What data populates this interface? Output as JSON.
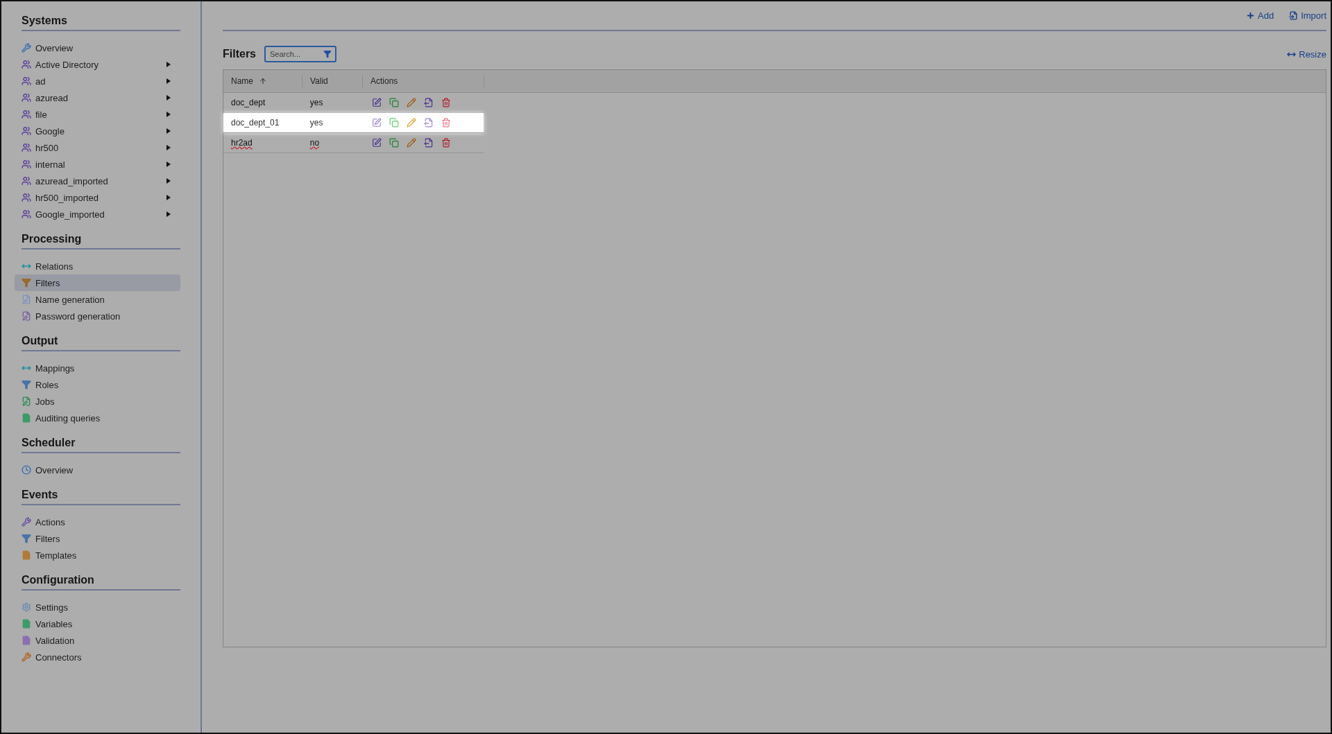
{
  "sidebar": {
    "sections": [
      {
        "title": "Systems",
        "items": [
          {
            "label": "Overview",
            "kind": "wrench",
            "color": "#3a6fb0",
            "expandable": false,
            "selected": false
          },
          {
            "label": "Active Directory",
            "kind": "group",
            "color": "#5b3f9a",
            "expandable": true,
            "selected": false
          },
          {
            "label": "ad",
            "kind": "group",
            "color": "#5b3f9a",
            "expandable": true,
            "selected": false
          },
          {
            "label": "azuread",
            "kind": "group",
            "color": "#5b3f9a",
            "expandable": true,
            "selected": false
          },
          {
            "label": "file",
            "kind": "group",
            "color": "#5b3f9a",
            "expandable": true,
            "selected": false
          },
          {
            "label": "Google",
            "kind": "group",
            "color": "#5b3f9a",
            "expandable": true,
            "selected": false
          },
          {
            "label": "hr500",
            "kind": "group",
            "color": "#5b3f9a",
            "expandable": true,
            "selected": false
          },
          {
            "label": "internal",
            "kind": "group",
            "color": "#5b3f9a",
            "expandable": true,
            "selected": false
          },
          {
            "label": "azuread_imported",
            "kind": "group",
            "color": "#5b3f9a",
            "expandable": true,
            "selected": false
          },
          {
            "label": "hr500_imported",
            "kind": "group",
            "color": "#5b3f9a",
            "expandable": true,
            "selected": false
          },
          {
            "label": "Google_imported",
            "kind": "group",
            "color": "#5b3f9a",
            "expandable": true,
            "selected": false
          }
        ]
      },
      {
        "title": "Processing",
        "items": [
          {
            "label": "Relations",
            "kind": "arrows",
            "color": "#1f8fa0",
            "expandable": false,
            "selected": false
          },
          {
            "label": "Filters",
            "kind": "filter",
            "color": "#9a6a2a",
            "expandable": false,
            "selected": true
          },
          {
            "label": "Name generation",
            "kind": "edit",
            "color": "#7a92c0",
            "expandable": false,
            "selected": false
          },
          {
            "label": "Password generation",
            "kind": "edit",
            "color": "#7a5fa0",
            "expandable": false,
            "selected": false
          }
        ]
      },
      {
        "title": "Output",
        "items": [
          {
            "label": "Mappings",
            "kind": "arrows",
            "color": "#1f8fa0",
            "expandable": false,
            "selected": false
          },
          {
            "label": "Roles",
            "kind": "filter",
            "color": "#4a73a8",
            "expandable": false,
            "selected": false
          },
          {
            "label": "Jobs",
            "kind": "edit",
            "color": "#2f8a55",
            "expandable": false,
            "selected": false
          },
          {
            "label": "Auditing queries",
            "kind": "doc",
            "color": "#3f9a6a",
            "expandable": false,
            "selected": false
          }
        ]
      },
      {
        "title": "Scheduler",
        "items": [
          {
            "label": "Overview",
            "kind": "clock",
            "color": "#3a6fb0",
            "expandable": false,
            "selected": false
          }
        ]
      },
      {
        "title": "Events",
        "items": [
          {
            "label": "Actions",
            "kind": "wrench",
            "color": "#6a4fa0",
            "expandable": false,
            "selected": false
          },
          {
            "label": "Filters",
            "kind": "filter",
            "color": "#4a73a8",
            "expandable": false,
            "selected": false
          },
          {
            "label": "Templates",
            "kind": "doc",
            "color": "#b07a3a",
            "expandable": false,
            "selected": false
          }
        ]
      },
      {
        "title": "Configuration",
        "items": [
          {
            "label": "Settings",
            "kind": "gear",
            "color": "#6a8ab0",
            "expandable": false,
            "selected": false
          },
          {
            "label": "Variables",
            "kind": "doc",
            "color": "#3f9a6a",
            "expandable": false,
            "selected": false
          },
          {
            "label": "Validation",
            "kind": "doc",
            "color": "#8a70b0",
            "expandable": false,
            "selected": false
          },
          {
            "label": "Connectors",
            "kind": "wrench",
            "color": "#b0601a",
            "expandable": false,
            "selected": false
          }
        ]
      }
    ]
  },
  "toolbar": {
    "add": "Add",
    "import": "Import"
  },
  "filters": {
    "title": "Filters",
    "search": {
      "placeholder": "Search..."
    },
    "resize": "Resize",
    "table": {
      "columns": [
        {
          "label": "Name",
          "sorted": true
        },
        {
          "label": "Valid",
          "sorted": false
        },
        {
          "label": "Actions",
          "sorted": false
        }
      ],
      "rows": [
        {
          "name": "doc_dept",
          "valid": "yes",
          "highlighted": false,
          "flagged": false
        },
        {
          "name": "doc_dept_01",
          "valid": "yes",
          "highlighted": true,
          "flagged": false
        },
        {
          "name": "hr2ad",
          "valid": "no",
          "highlighted": false,
          "flagged": true
        }
      ]
    }
  }
}
